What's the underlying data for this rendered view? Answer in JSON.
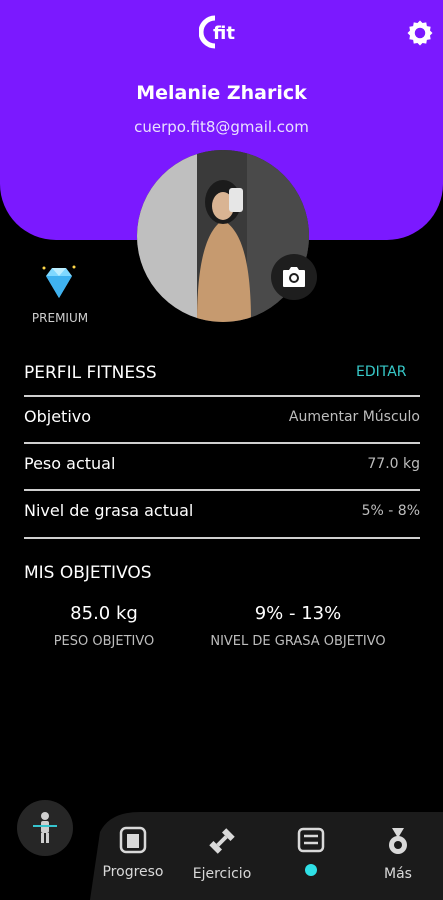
{
  "header": {
    "logo_text": "fit",
    "user_name": "Melanie Zharick",
    "email": "cuerpo.fit8@gmail.com"
  },
  "premium": {
    "label": "PREMIUM"
  },
  "profile": {
    "title": "PERFIL FITNESS",
    "edit_label": "EDITAR",
    "rows": [
      {
        "label": "Objetivo",
        "value": "Aumentar Músculo"
      },
      {
        "label": "Peso actual",
        "value": "77.0 kg"
      },
      {
        "label": "Nivel de grasa actual",
        "value": "5% - 8%"
      }
    ]
  },
  "goals": {
    "title": "MIS OBJETIVOS",
    "items": [
      {
        "value": "85.0 kg",
        "label": "PESO OBJETIVO"
      },
      {
        "value": "9% - 13%",
        "label": "NIVEL DE GRASA OBJETIVO"
      }
    ]
  },
  "nav": {
    "items": [
      {
        "label": "Progreso",
        "icon": "scale-icon"
      },
      {
        "label": "Ejercicio",
        "icon": "dumbbell-icon"
      },
      {
        "label": "",
        "icon": "profile-list-icon"
      },
      {
        "label": "Más",
        "icon": "medal-icon"
      }
    ]
  },
  "colors": {
    "primary": "#7b19ff",
    "accent": "#37c9c9",
    "active_dot": "#2fe0e6"
  }
}
